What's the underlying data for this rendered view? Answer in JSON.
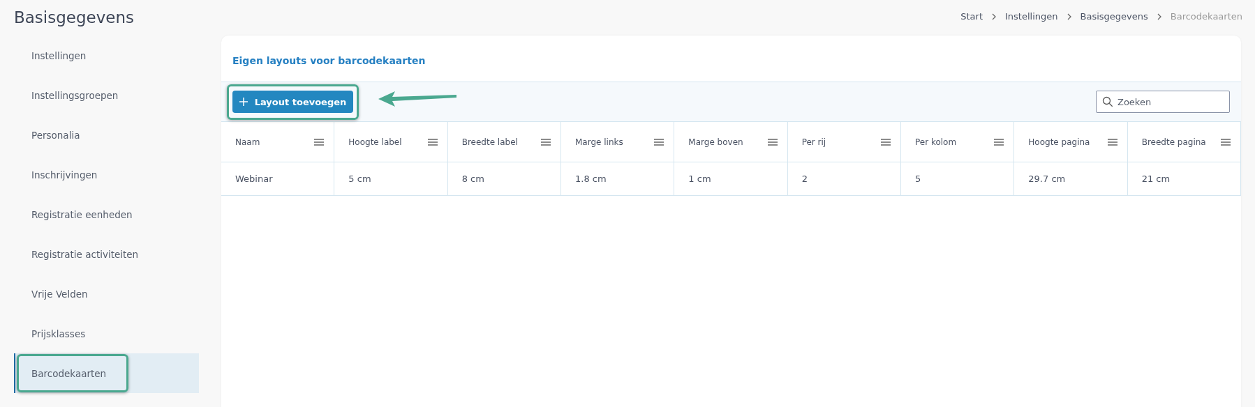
{
  "page": {
    "title": "Basisgegevens"
  },
  "breadcrumb": [
    {
      "label": "Start",
      "current": false
    },
    {
      "label": "Instellingen",
      "current": false
    },
    {
      "label": "Basisgegevens",
      "current": false
    },
    {
      "label": "Barcodekaarten",
      "current": true
    }
  ],
  "sidebar": {
    "items": [
      {
        "label": "Instellingen",
        "selected": false,
        "highlighted": false
      },
      {
        "label": "Instellingsgroepen",
        "selected": false,
        "highlighted": false
      },
      {
        "label": "Personalia",
        "selected": false,
        "highlighted": false
      },
      {
        "label": "Inschrijvingen",
        "selected": false,
        "highlighted": false
      },
      {
        "label": "Registratie eenheden",
        "selected": false,
        "highlighted": false
      },
      {
        "label": "Registratie activiteiten",
        "selected": false,
        "highlighted": false
      },
      {
        "label": "Vrije Velden",
        "selected": false,
        "highlighted": false
      },
      {
        "label": "Prijsklasses",
        "selected": false,
        "highlighted": false
      },
      {
        "label": "Barcodekaarten",
        "selected": true,
        "highlighted": true
      }
    ]
  },
  "card": {
    "title": "Eigen layouts voor barcodekaarten",
    "add_button": {
      "label": "Layout toevoegen",
      "highlighted": true,
      "pointer_arrow": true
    },
    "search": {
      "placeholder": "Zoeken"
    },
    "table": {
      "columns": [
        "Naam",
        "Hoogte label",
        "Breedte label",
        "Marge links",
        "Marge boven",
        "Per rij",
        "Per kolom",
        "Hoogte pagina",
        "Breedte pagina"
      ],
      "rows": [
        [
          "Webinar",
          "5 cm",
          "8 cm",
          "1.8 cm",
          "1 cm",
          "2",
          "5",
          "29.7 cm",
          "21 cm"
        ]
      ]
    }
  }
}
